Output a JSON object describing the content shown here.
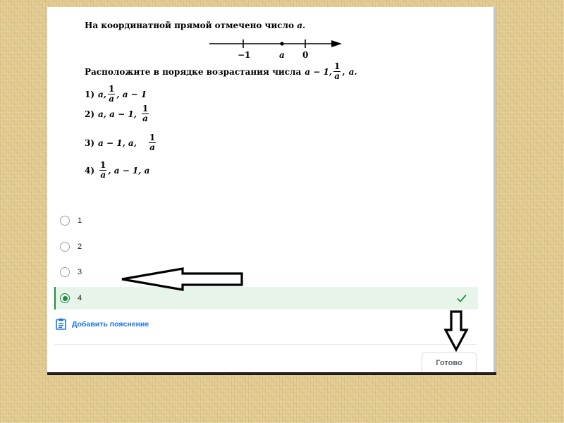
{
  "problem": {
    "line1": "На координатной прямой отмечено число",
    "var_a": "a",
    "period": ".",
    "axis_labels": {
      "minus_one": "−1",
      "a": "a",
      "zero": "0"
    },
    "line2_prefix": "Расположите в порядке возрастания числа",
    "a_minus_1": "a − 1,",
    "frac_num": "1",
    "frac_den": "a",
    "comma": ",",
    "a_period": "a.",
    "choice1_prefix": "1)",
    "choice1_a": "a,",
    "choice1_tail": ", a − 1",
    "choice2_prefix": "2)",
    "choice2_text": "a, a − 1,",
    "choice3_prefix": "3)",
    "choice3_text": "a − 1, a,",
    "choice4_prefix": "4)",
    "choice4_tail": ", a − 1, a"
  },
  "options": [
    {
      "label": "1",
      "selected": false
    },
    {
      "label": "2",
      "selected": false
    },
    {
      "label": "3",
      "selected": false
    },
    {
      "label": "4",
      "selected": true
    }
  ],
  "add_explanation_label": "Добавить пояснение",
  "done_button_label": "Готово",
  "icons": {
    "check": "check-icon",
    "clipboard": "clipboard-icon",
    "left_arrow": "left-arrow-icon",
    "down_arrow": "down-arrow-icon"
  },
  "colors": {
    "accent_green": "#1e8e3e",
    "selected_bg": "#e6f4ea",
    "link_blue": "#1a73e8",
    "background": "#e2cc92"
  }
}
